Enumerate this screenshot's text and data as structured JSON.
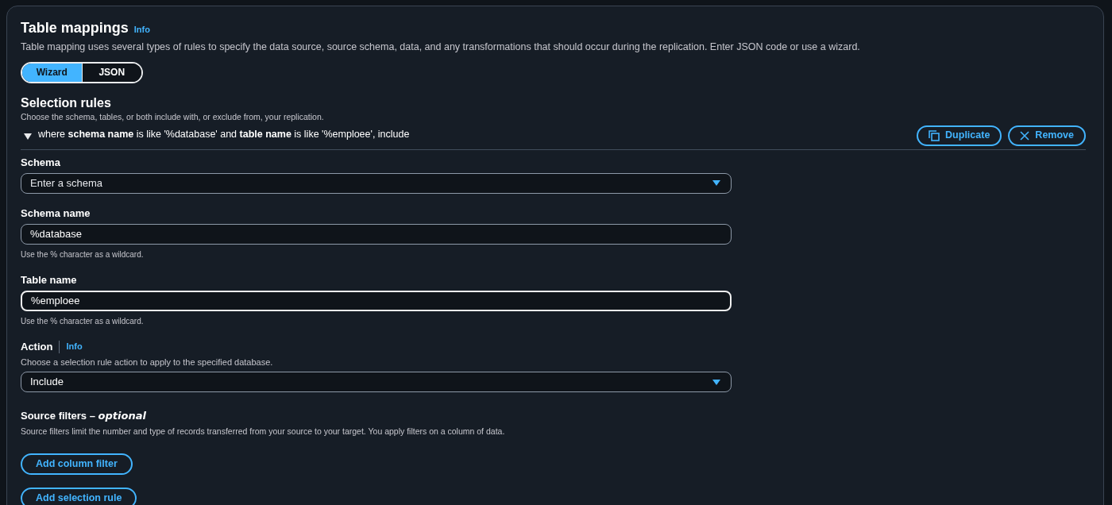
{
  "header": {
    "title": "Table mappings",
    "info": "Info",
    "description": "Table mapping uses several types of rules to specify the data source, source schema, data, and any transformations that should occur during the replication. Enter JSON code or use a wizard."
  },
  "mode_tabs": [
    {
      "label": "Wizard",
      "selected": true
    },
    {
      "label": "JSON",
      "selected": false
    }
  ],
  "selection_rules": {
    "title": "Selection rules",
    "description": "Choose the schema, tables, or both include with, or exclude from, your replication.",
    "rule": {
      "expanded": true,
      "summary": "where **schema name** is like '%database' and **table name** is like '%emploee', include",
      "buttons": [
        {
          "kind": "duplicate",
          "label": "Duplicate"
        },
        {
          "kind": "remove",
          "label": "Remove"
        }
      ]
    },
    "fields": [
      {
        "kind": "select",
        "label": "Schema",
        "placeholder": "Enter a schema"
      },
      {
        "kind": "input",
        "label": "Schema name",
        "value": "%database",
        "hint": "Use the % character as a wildcard.",
        "focused": false
      },
      {
        "kind": "input",
        "label": "Table name",
        "value": "%emploee",
        "hint": "Use the % character as a wildcard.",
        "focused": true
      },
      {
        "kind": "select",
        "label": "Action",
        "info": "Info",
        "description": "Choose a selection rule action to apply to the specified database.",
        "value": "Include"
      }
    ],
    "source_filters": {
      "title": "Source filters – ",
      "optional": "optional",
      "description": "Source filters limit the number and type of records transferred from your source to your target. You apply filters on a column of data.",
      "button": "Add column filter"
    },
    "add_button": "Add selection rule"
  }
}
